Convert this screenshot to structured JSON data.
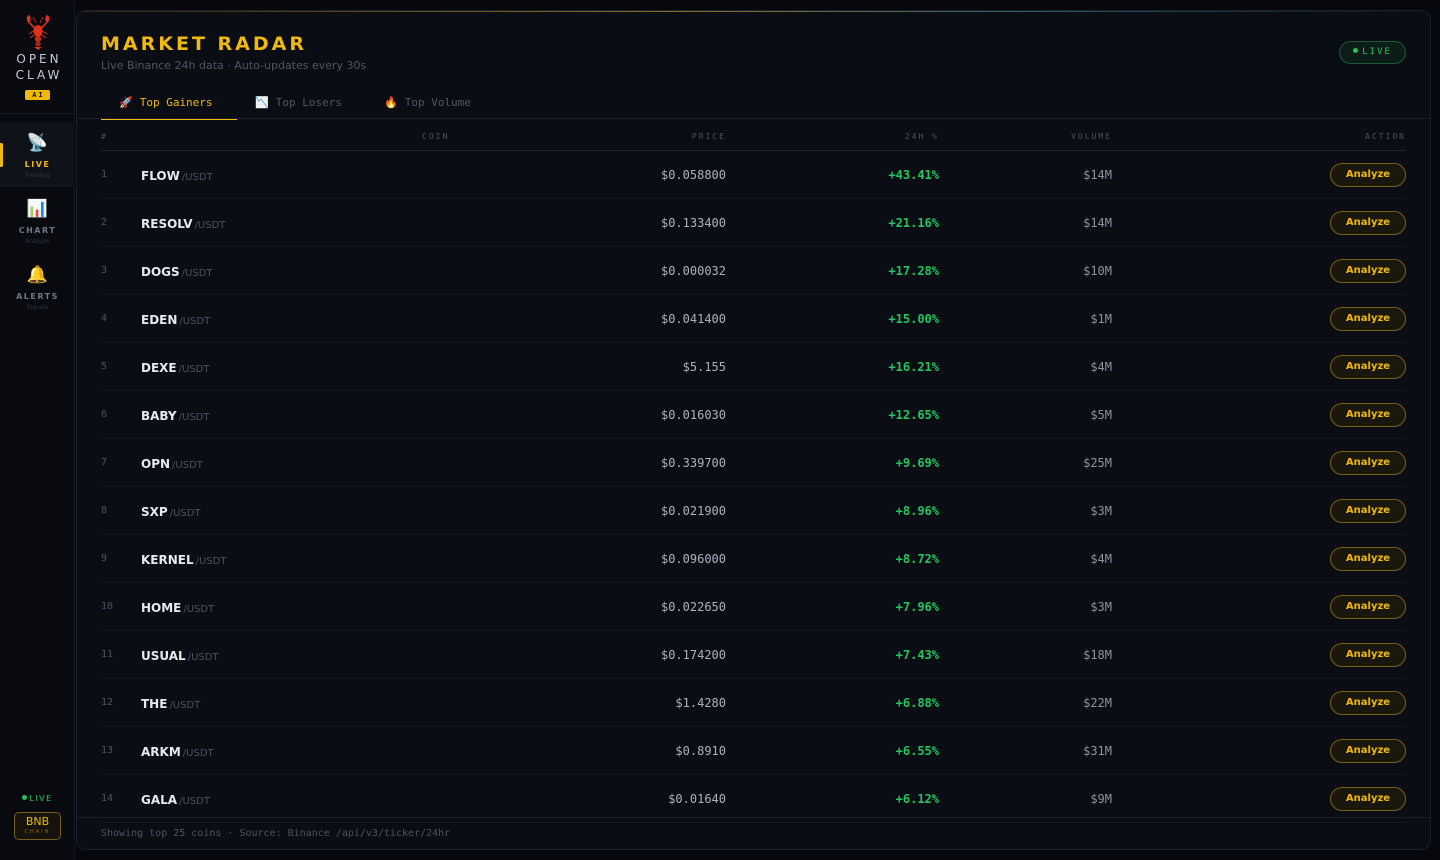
{
  "brand": {
    "line1": "OPEN",
    "line2": "CLAW",
    "badge": "AI",
    "logo_icon": "lobster-icon"
  },
  "nav": [
    {
      "icon": "📡",
      "icon_name": "satellite-icon",
      "label": "LIVE",
      "sub": "Trending",
      "active": true
    },
    {
      "icon": "📊",
      "icon_name": "bar-chart-icon",
      "label": "CHART",
      "sub": "Analysis",
      "active": false
    },
    {
      "icon": "🔔",
      "icon_name": "bell-icon",
      "label": "ALERTS",
      "sub": "Signals",
      "active": false
    }
  ],
  "sidebar_status": {
    "live": "LIVE",
    "chain_main": "BNB",
    "chain_sub": "CHAIN"
  },
  "header": {
    "title": "MARKET RADAR",
    "subtitle": "Live Binance 24h data · Auto-updates every 30s",
    "live_badge": "LIVE"
  },
  "tabs": [
    {
      "icon": "🚀",
      "icon_name": "rocket-icon",
      "label": "Top Gainers",
      "active": true
    },
    {
      "icon": "📉",
      "icon_name": "chart-down-icon",
      "label": "Top Losers",
      "active": false
    },
    {
      "icon": "🔥",
      "icon_name": "fire-icon",
      "label": "Top Volume",
      "active": false
    }
  ],
  "table": {
    "columns": {
      "rank": "#",
      "coin": "COIN",
      "price": "PRICE",
      "change": "24H %",
      "volume": "VOLUME",
      "action": "ACTION"
    },
    "action_label": "Analyze",
    "rows": [
      {
        "rank": "1",
        "symbol": "FLOW",
        "quote": "/USDT",
        "price": "$0.058800",
        "change": "+43.41%",
        "volume": "$14M"
      },
      {
        "rank": "2",
        "symbol": "RESOLV",
        "quote": "/USDT",
        "price": "$0.133400",
        "change": "+21.16%",
        "volume": "$14M"
      },
      {
        "rank": "3",
        "symbol": "DOGS",
        "quote": "/USDT",
        "price": "$0.000032",
        "change": "+17.28%",
        "volume": "$10M"
      },
      {
        "rank": "4",
        "symbol": "EDEN",
        "quote": "/USDT",
        "price": "$0.041400",
        "change": "+15.00%",
        "volume": "$1M"
      },
      {
        "rank": "5",
        "symbol": "DEXE",
        "quote": "/USDT",
        "price": "$5.155",
        "change": "+16.21%",
        "volume": "$4M"
      },
      {
        "rank": "6",
        "symbol": "BABY",
        "quote": "/USDT",
        "price": "$0.016030",
        "change": "+12.65%",
        "volume": "$5M"
      },
      {
        "rank": "7",
        "symbol": "OPN",
        "quote": "/USDT",
        "price": "$0.339700",
        "change": "+9.69%",
        "volume": "$25M"
      },
      {
        "rank": "8",
        "symbol": "SXP",
        "quote": "/USDT",
        "price": "$0.021900",
        "change": "+8.96%",
        "volume": "$3M"
      },
      {
        "rank": "9",
        "symbol": "KERNEL",
        "quote": "/USDT",
        "price": "$0.096000",
        "change": "+8.72%",
        "volume": "$4M"
      },
      {
        "rank": "10",
        "symbol": "HOME",
        "quote": "/USDT",
        "price": "$0.022650",
        "change": "+7.96%",
        "volume": "$3M"
      },
      {
        "rank": "11",
        "symbol": "USUAL",
        "quote": "/USDT",
        "price": "$0.174200",
        "change": "+7.43%",
        "volume": "$18M"
      },
      {
        "rank": "12",
        "symbol": "THE",
        "quote": "/USDT",
        "price": "$1.4280",
        "change": "+6.88%",
        "volume": "$22M"
      },
      {
        "rank": "13",
        "symbol": "ARKM",
        "quote": "/USDT",
        "price": "$0.8910",
        "change": "+6.55%",
        "volume": "$31M"
      },
      {
        "rank": "14",
        "symbol": "GALA",
        "quote": "/USDT",
        "price": "$0.01640",
        "change": "+6.12%",
        "volume": "$9M"
      }
    ]
  },
  "footer": "Showing top 25 coins · Source: Binance /api/v3/ticker/24hr",
  "colors": {
    "accent": "#f0b90b",
    "positive": "#22c55e",
    "background": "#06080d",
    "panel": "#0a0d14"
  }
}
